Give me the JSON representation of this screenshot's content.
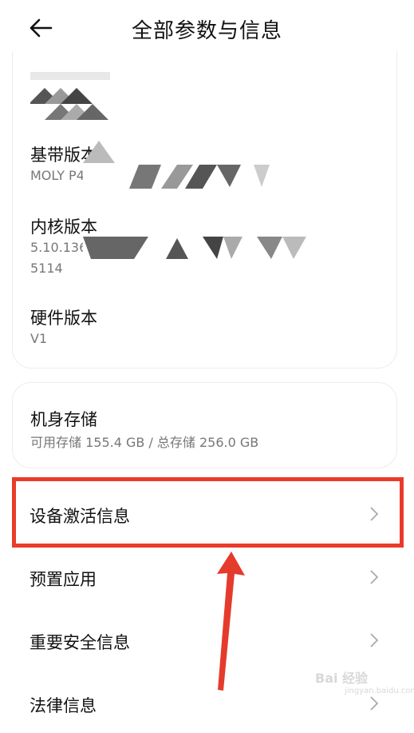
{
  "header": {
    "title": "全部参数与信息",
    "back_icon": "arrow-left-icon"
  },
  "details": {
    "baseband": {
      "title": "基带版本",
      "value": "MOLY P42"
    },
    "kernel": {
      "title": "内核版本",
      "value_line1": "5.10.136- 67-ab958",
      "value_line2": "5114"
    },
    "hardware": {
      "title": "硬件版本",
      "value": "V1"
    }
  },
  "storage": {
    "title": "机身存储",
    "detail": "可用存储 155.4 GB / 总存储 256.0 GB"
  },
  "menu": [
    {
      "label": "设备激活信息",
      "highlighted": true
    },
    {
      "label": "预置应用"
    },
    {
      "label": "重要安全信息"
    },
    {
      "label": "法律信息"
    }
  ],
  "annotation": {
    "color": "#ea3b2a"
  },
  "watermark": {
    "brand": "Bai 经验",
    "url": "jingyan.baidu.com"
  }
}
